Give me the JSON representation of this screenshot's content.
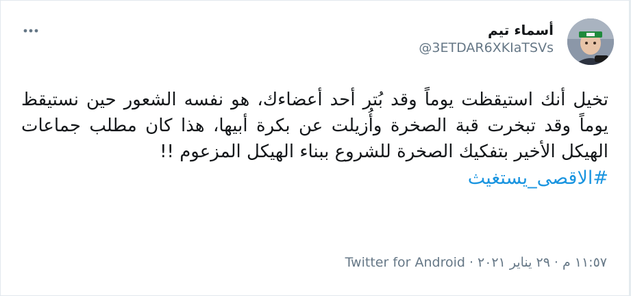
{
  "user": {
    "display_name": "أسماء تيم",
    "handle": "@3ETDAR6XKIaTSVs",
    "avatar_icon": "child-in-green-headband-photo"
  },
  "menu": {
    "icon": "more-dots-icon"
  },
  "tweet": {
    "text": "تخيل أنك استيقظت يوماً وقد بُتر أحد أعضاءك، هو نفسه الشعور حين نستيقظ يوماً وقد تبخرت قبة الصخرة وأُزيلت عن بكرة أبيها، هذا كان مطلب جماعات الهيكل الأخير بتفكيك الصخرة للشروع ببناء الهيكل المزعوم !!",
    "hashtag": "#الاقصى_يستغيث"
  },
  "meta": {
    "time": "١١:٥٧ م",
    "separator": "·",
    "date": "٢٩ يناير ٢٠٢١",
    "source": "Twitter for Android"
  },
  "colors": {
    "hashtag": "#1b95e0",
    "secondary_text": "#657786",
    "primary_text": "#14171a"
  }
}
